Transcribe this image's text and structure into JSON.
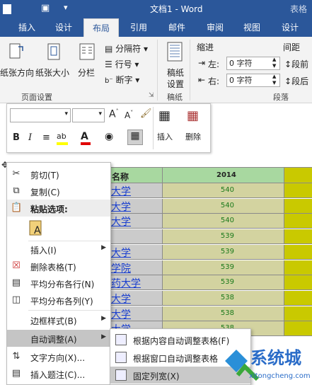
{
  "title_bar": {
    "app_icon_label": "■",
    "document_title": "文档1 - Word",
    "context_tab": "表格"
  },
  "tabs": [
    {
      "label": "插入"
    },
    {
      "label": "设计"
    },
    {
      "label": "布局"
    },
    {
      "label": "引用"
    },
    {
      "label": "邮件"
    },
    {
      "label": "审阅"
    },
    {
      "label": "视图"
    },
    {
      "label": "设计"
    }
  ],
  "active_tab_index": 2,
  "ribbon": {
    "page_setup": {
      "group_label": "页面设置",
      "orientation": "纸张方向",
      "size": "纸张大小",
      "columns": "分栏",
      "breaks": "分隔符",
      "line_numbers": "行号",
      "hyphenation": "断字"
    },
    "manuscript": {
      "group_label": "稿纸",
      "button_line1": "稿纸",
      "button_line2": "设置"
    },
    "paragraph": {
      "indent_label": "缩进",
      "spacing_label": "间距",
      "left_label": "左:",
      "right_label": "右:",
      "left_value": "0 字符",
      "right_value": "0 字符",
      "before_label": "段前",
      "after_label": "段后",
      "group_label": "段落"
    }
  },
  "mini_toolbar": {
    "bold": "B",
    "italic": "I",
    "insert_label": "插入",
    "delete_label": "删除",
    "grow_font": "A",
    "shrink_font": "A"
  },
  "table": {
    "header_name": "名称",
    "header_year": "2014",
    "rows": [
      {
        "name": "大学",
        "value": "540"
      },
      {
        "name": "大学",
        "value": "540"
      },
      {
        "name": "大学",
        "value": "540"
      },
      {
        "name": "",
        "value": "539"
      },
      {
        "name": "大学",
        "value": "539"
      },
      {
        "name": "学院",
        "value": "539"
      },
      {
        "name": "药大学",
        "value": "539"
      },
      {
        "name": "大学",
        "value": "538"
      },
      {
        "name": "大学",
        "value": "538"
      },
      {
        "name": "大学",
        "value": "538"
      }
    ]
  },
  "context_menu": {
    "cut": "剪切(T)",
    "copy": "复制(C)",
    "paste_options": "粘贴选项:",
    "insert": "插入(I)",
    "delete_table": "删除表格(T)",
    "distribute_rows": "平均分布各行(N)",
    "distribute_cols": "平均分布各列(Y)",
    "border_styles": "边框样式(B)",
    "autofit": "自动调整(A)",
    "text_direction": "文字方向(X)...",
    "insert_caption": "插入题注(C)..."
  },
  "autofit_submenu": {
    "fit_contents": "根据内容自动调整表格(F)",
    "fit_window": "根据窗口自动调整表格",
    "fixed_width": "固定列宽(X)"
  },
  "watermark": {
    "brand": "系统城",
    "url": "xitongcheng.com"
  },
  "colors": {
    "word_blue": "#2b579a",
    "ribbon_bg": "#f3f3f3",
    "name_col": "#cbcbcb",
    "value_col": "#d3d3a0",
    "yellow_col": "#c9c900",
    "header_green": "#a8d8a0"
  }
}
